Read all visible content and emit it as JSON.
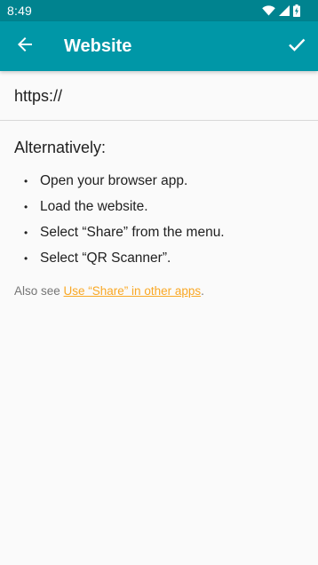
{
  "status_bar": {
    "time": "8:49",
    "icons": [
      "wifi-icon",
      "cell-signal-icon",
      "battery-charging-icon"
    ]
  },
  "app_bar": {
    "title": "Website",
    "back_icon": "arrow-back-icon",
    "confirm_icon": "check-icon"
  },
  "url_field": {
    "value": "https://"
  },
  "instructions": {
    "heading": "Alternatively:",
    "steps": [
      "Open your browser app.",
      "Load the website.",
      "Select “Share” from the menu.",
      "Select “QR Scanner”."
    ],
    "bullet": "•",
    "also_see_prefix": "Also see ",
    "also_see_link": "Use “Share” in other apps",
    "also_see_suffix": "."
  },
  "colors": {
    "status_bar": "#00838f",
    "app_bar": "#0097a7",
    "link": "#f9a825",
    "background": "#fafafa"
  }
}
